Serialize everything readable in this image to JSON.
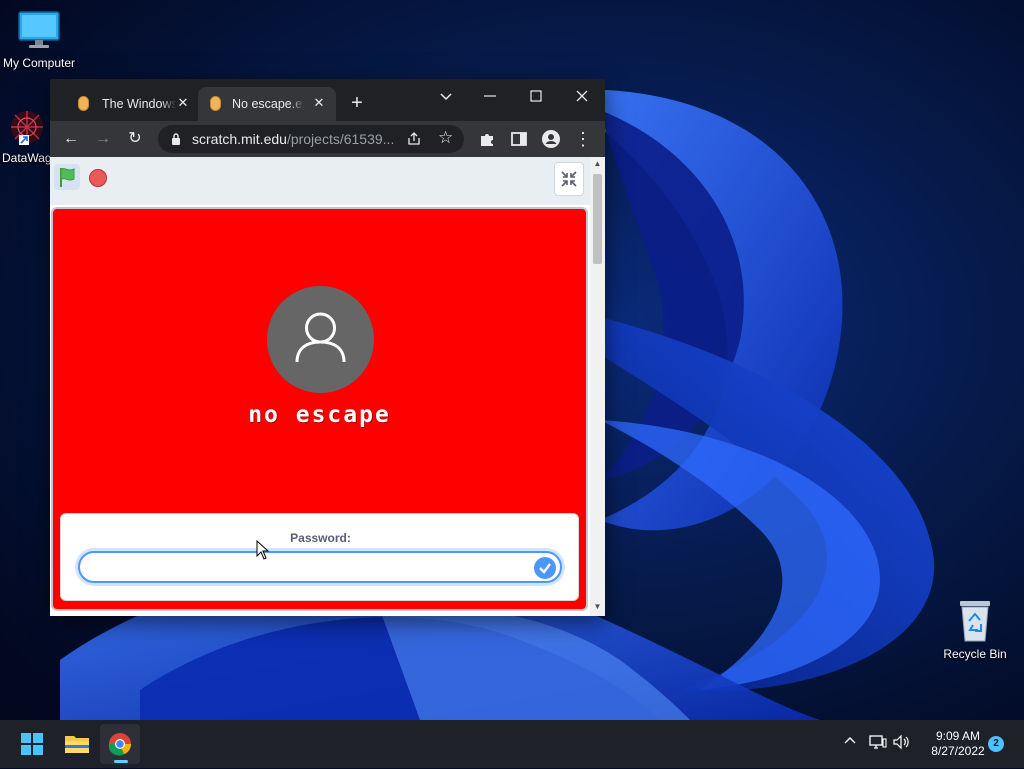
{
  "desktop": {
    "icons": [
      {
        "label": "My Computer",
        "icon": "monitor-icon"
      },
      {
        "label": "DataWag",
        "icon": "datawag-app-icon"
      },
      {
        "label": "Recycle Bin",
        "icon": "recycle-bin-icon"
      }
    ]
  },
  "browser": {
    "tabs": [
      {
        "title": "The Windows",
        "active": false,
        "icon": "scratch-cat-icon"
      },
      {
        "title": "No escape.exe",
        "active": true,
        "icon": "scratch-cat-icon"
      }
    ],
    "new_tab_label": "+",
    "window_controls": {
      "dropdown": "⌵",
      "minimize": "—",
      "maximize": "☐",
      "close": "✕"
    },
    "toolbar": {
      "back": "←",
      "forward": "→",
      "reload": "↻",
      "url_domain": "scratch.mit.edu",
      "url_path": "/projects/61539...",
      "share_icon": "share-icon",
      "bookmark": "☆",
      "extensions_icon": "puzzle-icon",
      "sidepanel_icon": "side-panel-icon",
      "profile_icon": "profile-icon",
      "menu": "⋮"
    }
  },
  "scratch": {
    "stage_color": "#fe0000",
    "sprite_text": "no escape",
    "ask_prompt": "Password:",
    "ask_value": "",
    "accent": "#4c97ff"
  },
  "taskbar": {
    "time": "9:09 AM",
    "date": "8/27/2022",
    "notification_count": "2",
    "tray_chevron": "^"
  }
}
